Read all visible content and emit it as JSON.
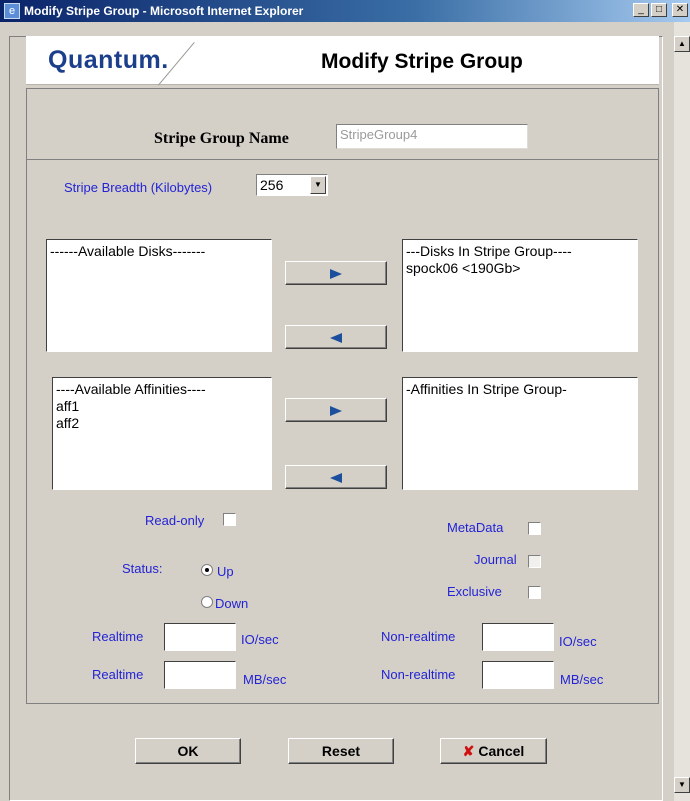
{
  "window": {
    "title": "Modify Stripe Group - Microsoft Internet Explorer"
  },
  "header": {
    "logo": "Quantum.",
    "page_title": "Modify Stripe Group"
  },
  "stripe_group_name": {
    "label": "Stripe Group Name",
    "value": "StripeGroup4"
  },
  "stripe_breadth": {
    "label": "Stripe Breadth (Kilobytes)",
    "value": "256"
  },
  "disks": {
    "available_header": "------Available Disks-------",
    "available": [],
    "in_group_header": "---Disks In Stripe Group----",
    "in_group": [
      "spock06  <190Gb>"
    ]
  },
  "affinities": {
    "available_header": "----Available Affinities----",
    "available": [
      "aff1",
      "aff2"
    ],
    "in_group_header": "-Affinities In Stripe Group-",
    "in_group": []
  },
  "options": {
    "read_only_label": "Read-only",
    "metadata_label": "MetaData",
    "journal_label": "Journal",
    "exclusive_label": "Exclusive",
    "status_label": "Status:",
    "up_label": "Up",
    "down_label": "Down",
    "status_selected": "Up"
  },
  "realtime": {
    "label": "Realtime",
    "non_label": "Non-realtime",
    "io_unit": "IO/sec",
    "mb_unit": "MB/sec"
  },
  "buttons": {
    "ok": "OK",
    "reset": "Reset",
    "cancel": "Cancel"
  },
  "colors": {
    "label_blue": "#2323d6",
    "logo_blue": "#1c3f8c",
    "cancel_x": "#d01010"
  }
}
